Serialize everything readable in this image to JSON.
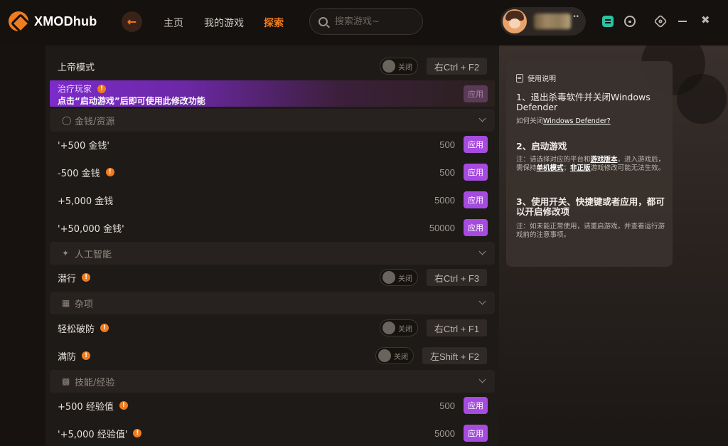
{
  "app": {
    "name": "XMODhub",
    "back_icon": "arrow-left-icon",
    "nav": [
      {
        "label": "主页",
        "active": false
      },
      {
        "label": "我的游戏",
        "active": false
      },
      {
        "label": "探索",
        "active": true
      }
    ],
    "search_placeholder": "搜索游戏~",
    "window_icons": [
      "sync-icon",
      "chat-icon",
      "settings-icon",
      "minimize-icon",
      "collapse-icon"
    ],
    "accent_color": "#f07c1e"
  },
  "mods": {
    "god_mode": {
      "label": "上帝模式",
      "toggle": "关闭",
      "hotkey": "右Ctrl + F2"
    },
    "heal_banner": {
      "title": "治疗玩家",
      "subtitle": "点击“启动游戏”后即可使用此修改功能",
      "apply": "应用"
    },
    "section_money": {
      "label": "金钱/资源"
    },
    "money": [
      {
        "label": "'+500 金钱'",
        "value": "500",
        "apply": "应用"
      },
      {
        "label": "-500 金钱",
        "value": "500",
        "apply": "应用"
      },
      {
        "label": "+5,000 金钱",
        "value": "5000",
        "apply": "应用"
      },
      {
        "label": "'+50,000 金钱'",
        "value": "50000",
        "apply": "应用"
      }
    ],
    "section_ai": {
      "label": "人工智能"
    },
    "stealth": {
      "label": "潜行",
      "toggle": "关闭",
      "hotkey": "右Ctrl + F3"
    },
    "section_misc": {
      "label": "杂项"
    },
    "easy_break": {
      "label": "轻松破防",
      "toggle": "关闭",
      "hotkey": "右Ctrl + F1"
    },
    "full_defense": {
      "label": "满防",
      "toggle": "关闭",
      "hotkey": "左Shift + F2"
    },
    "section_skill": {
      "label": "技能/经验"
    },
    "xp": [
      {
        "label": "+500 经验值",
        "value": "500",
        "apply": "应用"
      },
      {
        "label": "'+5,000 经验值'",
        "value": "5000",
        "apply": "应用"
      }
    ]
  },
  "guide": {
    "header": "使用说明",
    "step1_title": "1、退出杀毒软件并关闭Windows Defender",
    "step1_note_prefix": "如何关闭",
    "step1_note_link": "Windows Defender?",
    "step2_title": "2、启动游戏",
    "step2_note_a": "注：请选择对应的平台和",
    "step2_note_b": "游戏版本",
    "step2_note_c": "，进入游戏后，需保持",
    "step2_note_d": "单机模式",
    "step2_note_e": "；",
    "step2_note_f": "非正版",
    "step2_note_g": "游戏修改可能无法生效。",
    "step3_title": "3、使用开关、快捷键或者应用，都可以开启修改项",
    "step3_note": "注：如未能正常使用，请重启游戏，并查看运行游戏前的注意事项。"
  }
}
